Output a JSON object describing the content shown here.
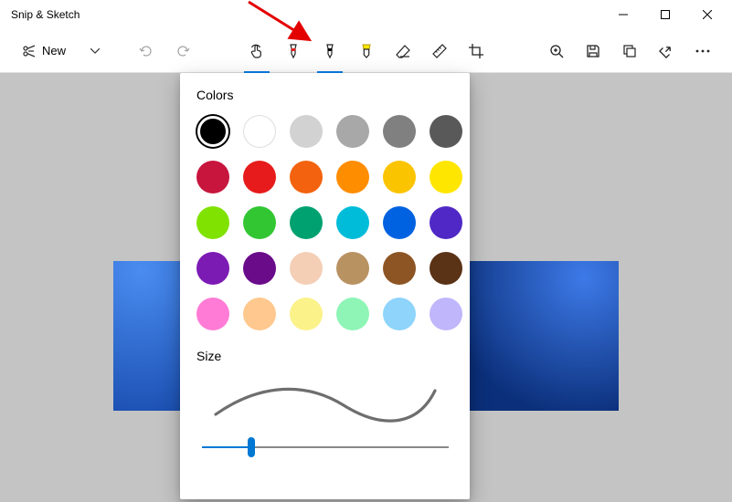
{
  "window": {
    "title": "Snip & Sketch"
  },
  "toolbar": {
    "new_label": "New",
    "tools": {
      "touch": "touch-writing",
      "pen_red": "ballpoint-pen-red",
      "pen_black": "ballpoint-pen-black",
      "highlighter": "highlighter",
      "eraser": "eraser",
      "ruler": "ruler",
      "crop": "crop"
    },
    "right": {
      "zoom": "zoom",
      "save": "save",
      "copy": "copy",
      "share": "share",
      "more": "see-more"
    },
    "active_tool": "ballpoint-pen-black",
    "touch_enabled": true
  },
  "popup": {
    "colors_label": "Colors",
    "size_label": "Size",
    "selected_color_index": 0,
    "colors": [
      "#000000",
      "#ffffff",
      "#d2d2d2",
      "#a8a8a8",
      "#808080",
      "#595959",
      "#c7153d",
      "#e71b1b",
      "#f3620e",
      "#ff8d00",
      "#fbc400",
      "#ffe600",
      "#80e200",
      "#33c633",
      "#00a170",
      "#00bcd9",
      "#0062e0",
      "#5028c5",
      "#7c1ab4",
      "#6a0b8a",
      "#f4cfb6",
      "#b99262",
      "#8d5524",
      "#5a3216",
      "#ff7bd6",
      "#ffc88e",
      "#fbf28a",
      "#8ef5b6",
      "#8ed4fb",
      "#c0b6fb"
    ],
    "slider_value_percent": 20
  },
  "canvas": {
    "image_description": "Windows 11 blue abstract bloom wallpaper crop"
  }
}
